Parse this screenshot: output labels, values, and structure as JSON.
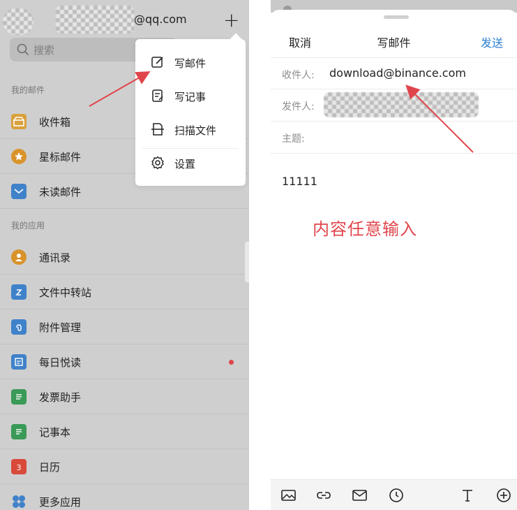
{
  "left_panel": {
    "account_suffix": "@qq.com",
    "search": {
      "placeholder": "搜索"
    },
    "sections": {
      "my_mail": "我的邮件",
      "my_apps": "我的应用"
    },
    "mail_items": [
      {
        "label": "收件箱",
        "icon": "inbox-icon",
        "color": "#d9a13b"
      },
      {
        "label": "星标邮件",
        "icon": "star-icon",
        "color": "#d8932a"
      },
      {
        "label": "未读邮件",
        "icon": "unread-icon",
        "color": "#3f82c9"
      }
    ],
    "app_items": [
      {
        "label": "通讯录",
        "icon": "contacts-icon",
        "color": "#d8932a"
      },
      {
        "label": "文件中转站",
        "icon": "file-transfer-icon",
        "color": "#3f82c9"
      },
      {
        "label": "附件管理",
        "icon": "attachment-icon",
        "color": "#3f82c9"
      },
      {
        "label": "每日悦读",
        "icon": "daily-read-icon",
        "color": "#3f82c9",
        "has_dot": true
      },
      {
        "label": "发票助手",
        "icon": "invoice-icon",
        "color": "#3a9a57"
      },
      {
        "label": "记事本",
        "icon": "notebook-icon",
        "color": "#3a9a57"
      },
      {
        "label": "日历",
        "icon": "calendar-icon",
        "color": "#d94a3a",
        "calendar_day": "3"
      },
      {
        "label": "更多应用",
        "icon": "more-apps-icon",
        "color": "#3f82c9"
      }
    ],
    "popup_menu": [
      {
        "label": "写邮件",
        "icon": "compose-icon"
      },
      {
        "label": "写记事",
        "icon": "write-note-icon"
      },
      {
        "label": "扫描文件",
        "icon": "scan-icon"
      },
      {
        "label": "设置",
        "icon": "settings-icon"
      }
    ]
  },
  "right_panel": {
    "header": {
      "cancel": "取消",
      "title": "写邮件",
      "send": "发送"
    },
    "fields": {
      "to_label": "收件人:",
      "to_value": "download@binance.com",
      "from_label": "发件人:",
      "subject_label": "主题:"
    },
    "body": "11111",
    "annotation": "内容任意输入",
    "toolbar": [
      "image-icon",
      "link-icon",
      "envelope-icon",
      "clock-icon",
      "text-format-icon",
      "add-icon"
    ]
  },
  "colors": {
    "accent_blue": "#2d7fd4",
    "annotation_red": "#e0454b",
    "panel_gray": "#cfcfcf"
  }
}
